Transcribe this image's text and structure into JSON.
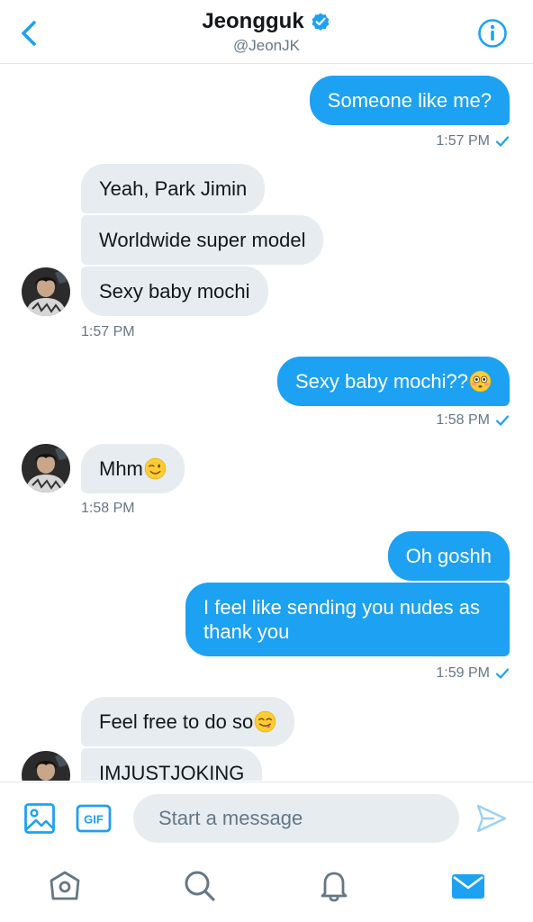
{
  "header": {
    "title": "Jeongguk",
    "handle": "@JeonJK",
    "verified": true
  },
  "colors": {
    "accent": "#1da1f2",
    "incoming_bubble": "#e6ecf0",
    "secondary_text": "#657786"
  },
  "messages": {
    "m1": {
      "text": "Someone like me?",
      "direction": "outgoing"
    },
    "t1": "1:57 PM",
    "m2": {
      "text": "Yeah, Park Jimin",
      "direction": "incoming"
    },
    "m3": {
      "text": "Worldwide super model",
      "direction": "incoming"
    },
    "m4": {
      "text": "Sexy baby mochi",
      "direction": "incoming"
    },
    "t2": "1:57 PM",
    "m5": {
      "text": "Sexy baby mochi??",
      "emoji": "flushed-face",
      "direction": "outgoing"
    },
    "t3": "1:58 PM",
    "m6": {
      "text": "Mhm",
      "emoji": "winking-face",
      "direction": "incoming"
    },
    "t4": "1:58 PM",
    "m7": {
      "text": "Oh goshh",
      "direction": "outgoing"
    },
    "m8": {
      "text": "I feel like sending you nudes as thank you",
      "direction": "outgoing"
    },
    "t5": "1:59 PM",
    "m9": {
      "text": "Feel free to do so",
      "emoji": "face-savoring-food",
      "direction": "incoming"
    },
    "m10": {
      "text": "IMJUSTJOKING",
      "direction": "incoming"
    }
  },
  "composer": {
    "placeholder": "Start a message",
    "gif_label": "GIF"
  },
  "tabs": [
    "home-icon",
    "search-icon",
    "notifications-icon",
    "messages-icon"
  ]
}
